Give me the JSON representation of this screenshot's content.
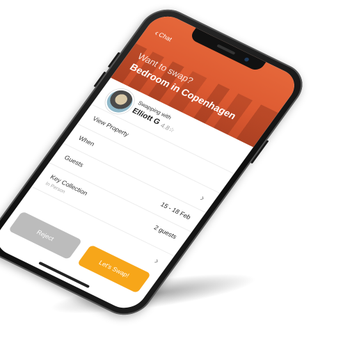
{
  "header": {
    "back_label": "Chat",
    "subtitle": "Want to swap?",
    "title": "Bedroom in Copenhagen"
  },
  "host": {
    "swapping_label": "Swapping with",
    "name": "Elliott G",
    "rating": "4.8☆"
  },
  "rows": {
    "view_property": "View Property",
    "when_label": "When",
    "guests_label": "Guests",
    "guests_dates": "15 - 18 Feb",
    "key_collection_label": "Key Collection",
    "key_collection_sub": "In Person",
    "guests_count": "2 guests"
  },
  "actions": {
    "reject_label": "Reject",
    "swap_label": "Let's Swap!"
  },
  "colors": {
    "header": "#dd5a31",
    "swap_button": "#f7a619",
    "reject_button": "#bcbcbc"
  },
  "icons": [
    "back-chevron-icon",
    "star-icon",
    "chevron-right-icon"
  ]
}
